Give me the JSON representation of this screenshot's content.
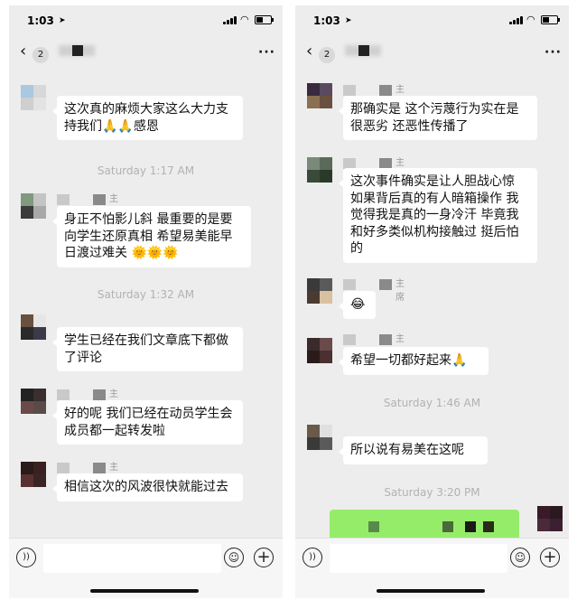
{
  "left": {
    "status": {
      "time": "1:03"
    },
    "nav": {
      "badge": "2",
      "more": "···"
    },
    "messages": [
      {
        "text": "这次真的麻烦大家这么大力支持我们🙏🙏感恩"
      },
      {
        "timestamp": "Saturday 1:17 AM"
      },
      {
        "role": "主席",
        "text": "身正不怕影儿斜 最重要的是要向学生还原真相 希望易美能早日渡过难关 🌞🌞🌞"
      },
      {
        "timestamp": "Saturday 1:32 AM"
      },
      {
        "text": "学生已经在我们文章底下都做了评论"
      },
      {
        "role": "主席",
        "text": "好的呢 我们已经在动员学生会成员都一起转发啦"
      },
      {
        "role": "主席",
        "text": "相信这次的风波很快就能过去"
      }
    ]
  },
  "right": {
    "status": {
      "time": "1:03"
    },
    "nav": {
      "badge": "2",
      "more": "···"
    },
    "messages": [
      {
        "role": "主席",
        "text": "那确实是 这个污蔑行为实在是很恶劣 还恶性传播了"
      },
      {
        "role": "主席",
        "text": "这次事件确实是让人胆战心惊 如果背后真的有人暗箱操作 我觉得我是真的一身冷汗 毕竟我和好多类似机构接触过 挺后怕的"
      },
      {
        "role": "主席",
        "text": "😂"
      },
      {
        "role": "主席",
        "text": "希望一切都好起来🙏"
      },
      {
        "timestamp": "Saturday 1:46 AM"
      },
      {
        "text": "所以说有易美在这呢"
      },
      {
        "timestamp": "Saturday 3:20 PM"
      }
    ]
  },
  "icons": {
    "back": "‹",
    "location": "➤",
    "wifi": "wifi-icon",
    "voice": "))",
    "emoji": "☺",
    "plus": "+"
  },
  "colors": {
    "chat_bg": "#ededed",
    "bubble": "#ffffff",
    "self_bubble": "#95ec69",
    "timestamp": "#b2b2b2"
  }
}
